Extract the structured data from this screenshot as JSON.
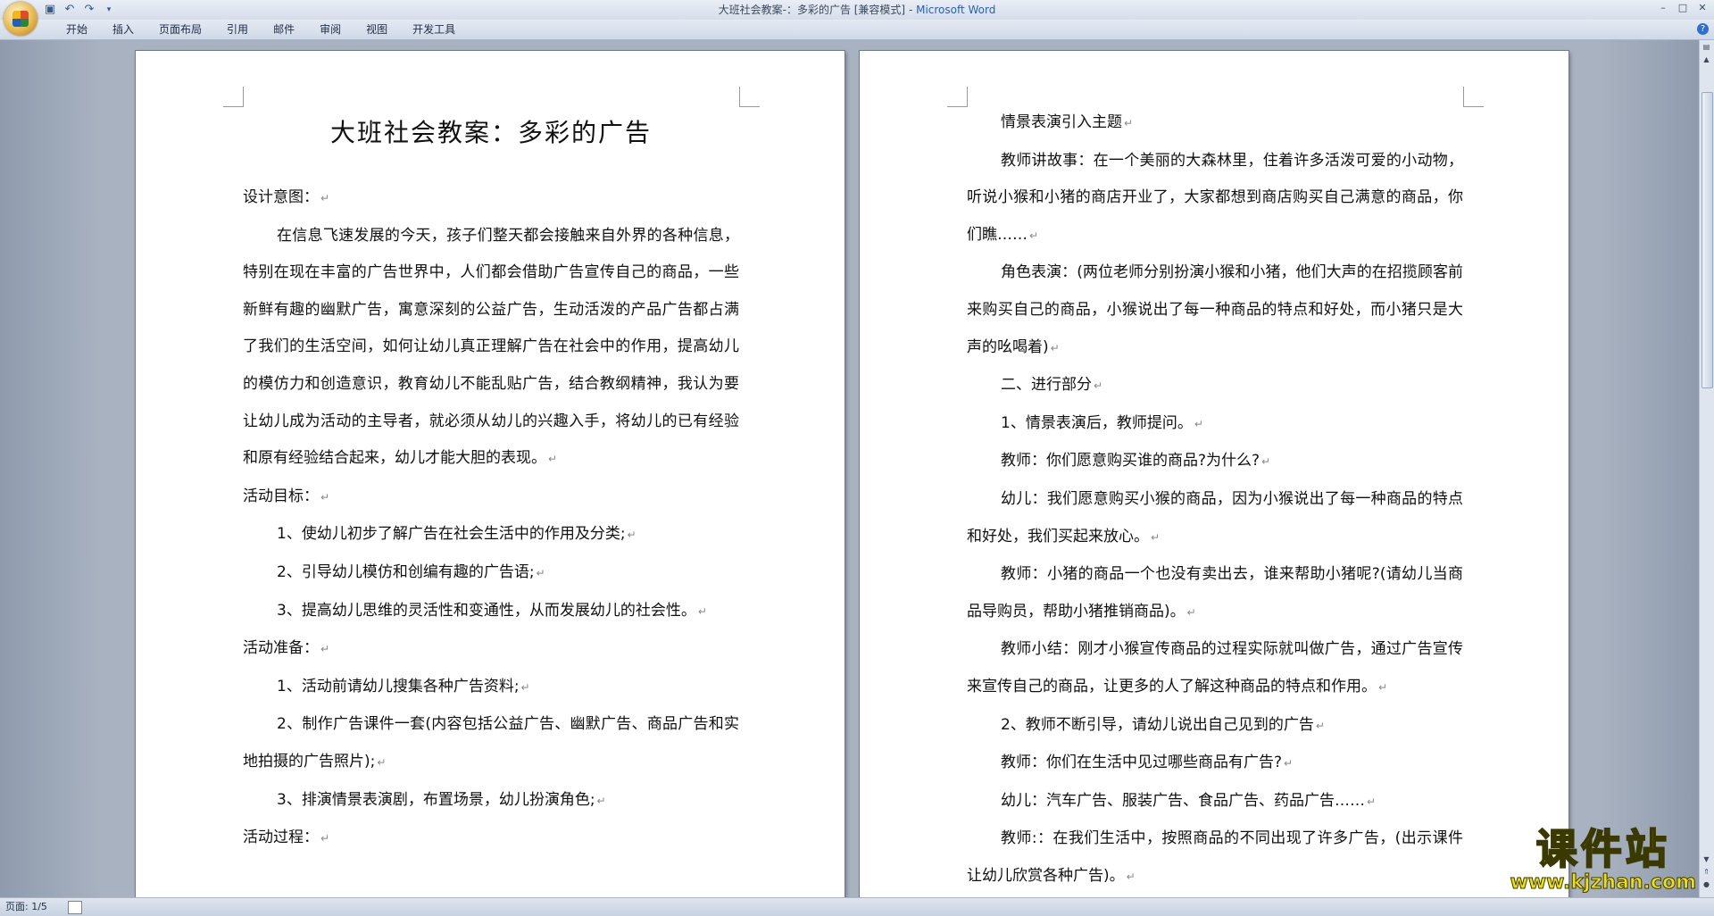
{
  "window": {
    "title_doc": "大班社会教案-：多彩的广告 [兼容模式]",
    "title_sep": " - ",
    "title_app": "Microsoft Word"
  },
  "menu": {
    "items": [
      "开始",
      "插入",
      "页面布局",
      "引用",
      "邮件",
      "审阅",
      "视图",
      "开发工具"
    ]
  },
  "page_left": {
    "title": "大班社会教案：多彩的广告",
    "paragraphs": [
      {
        "text": "设计意图：",
        "indent": false
      },
      {
        "text": "在信息飞速发展的今天，孩子们整天都会接触来自外界的各种信息，特别在现在丰富的广告世界中，人们都会借助广告宣传自己的商品，一些新鲜有趣的幽默广告，寓意深刻的公益广告，生动活泼的产品广告都占满了我们的生活空间，如何让幼儿真正理解广告在社会中的作用，提高幼儿的模仿力和创造意识，教育幼儿不能乱贴广告，结合教纲精神，我认为要让幼儿成为活动的主导者，就必须从幼儿的兴趣入手，将幼儿的已有经验和原有经验结合起来，幼儿才能大胆的表现。",
        "indent": true
      },
      {
        "text": "活动目标：",
        "indent": false
      },
      {
        "text": "1、使幼儿初步了解广告在社会生活中的作用及分类;",
        "indent": true
      },
      {
        "text": "2、引导幼儿模仿和创编有趣的广告语;",
        "indent": true
      },
      {
        "text": "3、提高幼儿思维的灵活性和变通性，从而发展幼儿的社会性。",
        "indent": true
      },
      {
        "text": "活动准备：",
        "indent": false
      },
      {
        "text": "1、活动前请幼儿搜集各种广告资料;",
        "indent": true
      },
      {
        "text": "2、制作广告课件一套(内容包括公益广告、幽默广告、商品广告和实地拍摄的广告照片);",
        "indent": true
      },
      {
        "text": "3、排演情景表演剧，布置场景，幼儿扮演角色;",
        "indent": true
      },
      {
        "text": "活动过程：",
        "indent": false
      }
    ]
  },
  "page_right": {
    "paragraphs": [
      {
        "text": "情景表演引入主题",
        "indent": true
      },
      {
        "text": "教师讲故事：在一个美丽的大森林里，住着许多活泼可爱的小动物，听说小猴和小猪的商店开业了，大家都想到商店购买自己满意的商品，你们瞧……",
        "indent": true
      },
      {
        "text": "角色表演：(两位老师分别扮演小猴和小猪，他们大声的在招揽顾客前来购买自己的商品，小猴说出了每一种商品的特点和好处，而小猪只是大声的吆喝着)",
        "indent": true
      },
      {
        "text": "二、进行部分",
        "indent": true
      },
      {
        "text": "1、情景表演后，教师提问。",
        "indent": true
      },
      {
        "text": "教师：你们愿意购买谁的商品?为什么?",
        "indent": true
      },
      {
        "text": "幼儿：我们愿意购买小猴的商品，因为小猴说出了每一种商品的特点和好处，我们买起来放心。",
        "indent": true
      },
      {
        "text": "教师：小猪的商品一个也没有卖出去，谁来帮助小猪呢?(请幼儿当商品导购员，帮助小猪推销商品)。",
        "indent": true
      },
      {
        "text": "教师小结：刚才小猴宣传商品的过程实际就叫做广告，通过广告宣传来宣传自己的商品，让更多的人了解这种商品的特点和作用。",
        "indent": true
      },
      {
        "text": "2、教师不断引导，请幼儿说出自己见到的广告",
        "indent": true
      },
      {
        "text": "教师：你们在生活中见过哪些商品有广告?",
        "indent": true
      },
      {
        "text": "幼儿：汽车广告、服装广告、食品广告、药品广告……",
        "indent": true
      },
      {
        "text": "教师:：在我们生活中，按照商品的不同出现了许多广告，(出示课件让幼儿欣赏各种广告)。",
        "indent": true
      }
    ]
  },
  "paragraph_mark": "↵",
  "status": {
    "page": "页面: 1/5"
  },
  "watermark": {
    "name": "课件站",
    "url": "www.kjzhan.com"
  }
}
